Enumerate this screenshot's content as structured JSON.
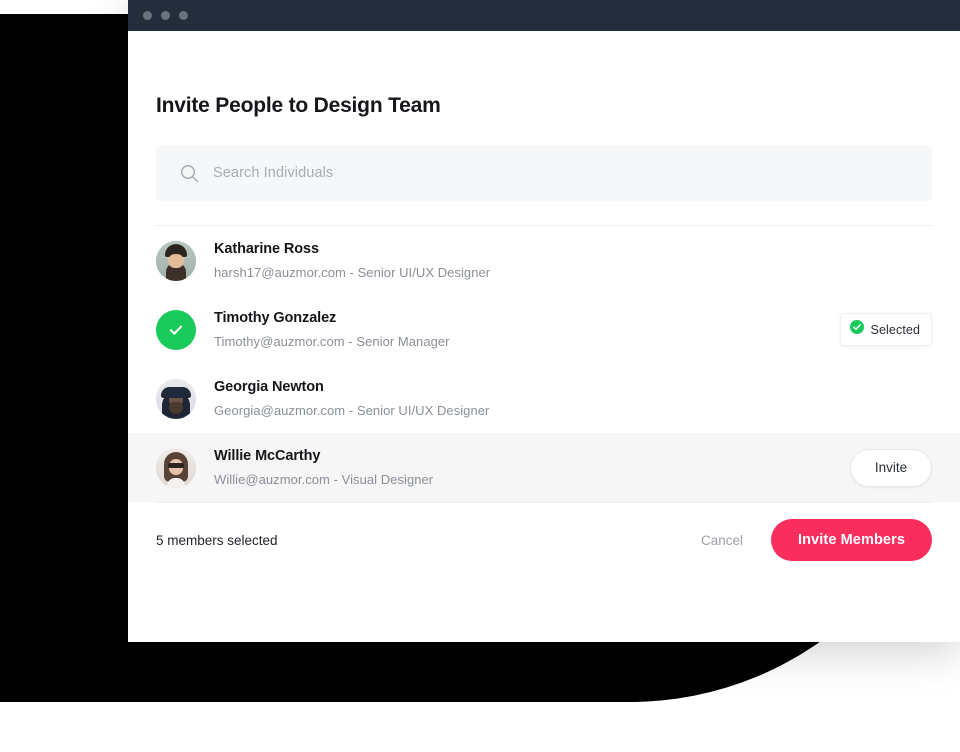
{
  "window": {
    "title_bar_dots": 3,
    "chrome_color": "#242d3c"
  },
  "dialog": {
    "title": "Invite People to Design Team"
  },
  "search": {
    "icon": "search-icon",
    "placeholder": "Search Individuals",
    "value": ""
  },
  "people": [
    {
      "name": "Katharine Ross",
      "meta": "harsh17@auzmor.com - Senior UI/UX Designer",
      "avatar_type": "photo",
      "state": "none",
      "action": ""
    },
    {
      "name": "Timothy Gonzalez",
      "meta": "Timothy@auzmor.com - Senior Manager",
      "avatar_type": "check",
      "state": "selected",
      "action": "Selected"
    },
    {
      "name": "Georgia Newton",
      "meta": "Georgia@auzmor.com - Senior UI/UX Designer",
      "avatar_type": "photo",
      "state": "none",
      "action": ""
    },
    {
      "name": "Willie McCarthy",
      "meta": "Willie@auzmor.com - Visual Designer",
      "avatar_type": "photo",
      "state": "hover",
      "action": "Invite"
    }
  ],
  "footer": {
    "count_label": "5 members selected",
    "cancel_label": "Cancel",
    "primary_label": "Invite Members"
  },
  "colors": {
    "accent_pink": "#fa2d5f",
    "success_green": "#19cb5b",
    "chrome_dark": "#242d3c",
    "row_hover": "#f6f6f7",
    "search_bg": "#f6f7f8",
    "text_primary": "#14161a",
    "text_muted": "#8a8f98"
  }
}
